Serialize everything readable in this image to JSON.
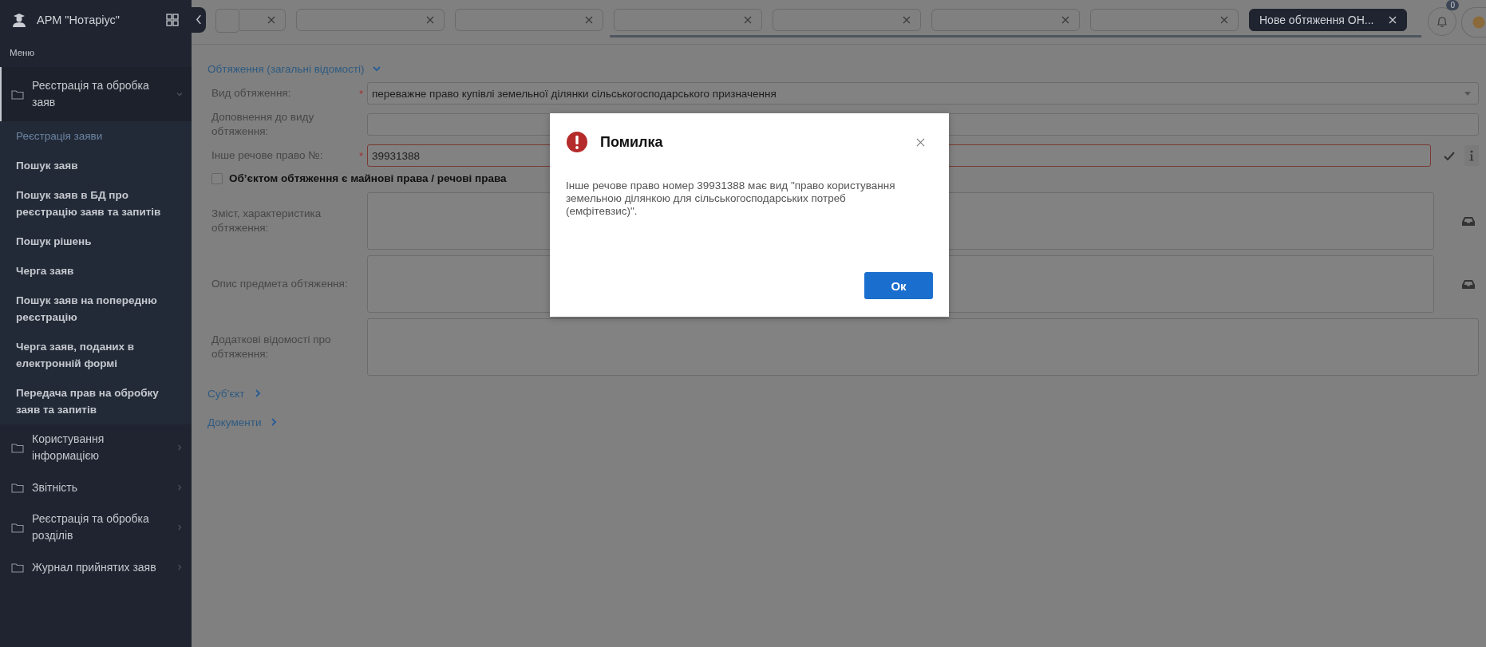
{
  "sidebar": {
    "title": "АРМ \"Нотаріус\"",
    "menu_label": "Меню",
    "groups": [
      {
        "label": "Реєстрація та обробка заяв",
        "expanded": true,
        "children": [
          {
            "label": "Реєстрація заяви",
            "selected": true
          },
          {
            "label": "Пошук заяв",
            "selected": false
          },
          {
            "label": "Пошук заяв в БД про реєстрацію заяв та запитів",
            "selected": false
          },
          {
            "label": "Пошук рішень",
            "selected": false
          },
          {
            "label": "Черга заяв",
            "selected": false
          },
          {
            "label": "Пошук заяв на попередню реєстрацію",
            "selected": false
          },
          {
            "label": "Черга заяв, поданих в електронній формі",
            "selected": false
          },
          {
            "label": "Передача прав на обробку заяв та запитів",
            "selected": false
          }
        ]
      },
      {
        "label": "Користування інформацією",
        "expanded": false
      },
      {
        "label": "Звітність",
        "expanded": false
      },
      {
        "label": "Реєстрація та обробка розділів",
        "expanded": false
      },
      {
        "label": "Журнал прийнятих заяв",
        "expanded": false
      }
    ]
  },
  "tabs": [
    {
      "selected": false
    },
    {
      "selected": false
    },
    {
      "selected": false
    },
    {
      "selected": false
    },
    {
      "selected": false
    },
    {
      "selected": false
    },
    {
      "selected": false
    },
    {
      "label": "Нове обтяження ОН...",
      "selected": true
    }
  ],
  "notifications": {
    "count": "0"
  },
  "form": {
    "section": {
      "title": "Обтяження (загальні відомості)",
      "expanded": true
    },
    "fields": [
      {
        "kind": "select",
        "label": "Вид обтяження:",
        "required_mark": "*",
        "invalid": false,
        "value": "переважне право купівлі земельної ділянки сільськогосподарського призначення"
      },
      {
        "kind": "text",
        "label": "Доповнення до виду обтяження:",
        "invalid": false
      },
      {
        "kind": "validated",
        "label": "Інше речове право №:",
        "required_mark": "*",
        "invalid": true,
        "value": "39931388"
      },
      {
        "kind": "checkbox",
        "label": "Об’єктом обтяження є майнові права / речові права",
        "checked": false
      },
      {
        "kind": "textarea-tool",
        "label": "Зміст, характеристика обтяження:",
        "invalid": false
      },
      {
        "kind": "textarea-tool",
        "label": "Опис предмета обтяження:",
        "invalid": false
      },
      {
        "kind": "textarea",
        "label": "Додаткові відомості про обтяження:",
        "invalid": false
      }
    ],
    "sections": [
      {
        "title": "Суб’єкт",
        "expanded": false
      },
      {
        "title": "Документи",
        "expanded": false
      }
    ]
  },
  "dialog": {
    "title": "Помилка",
    "message": "Інше речове право номер 39931388 має вид \"право користування земельною ділянкою для сільськогосподарських потреб (емфітевзис)\".",
    "button": "Ок"
  }
}
